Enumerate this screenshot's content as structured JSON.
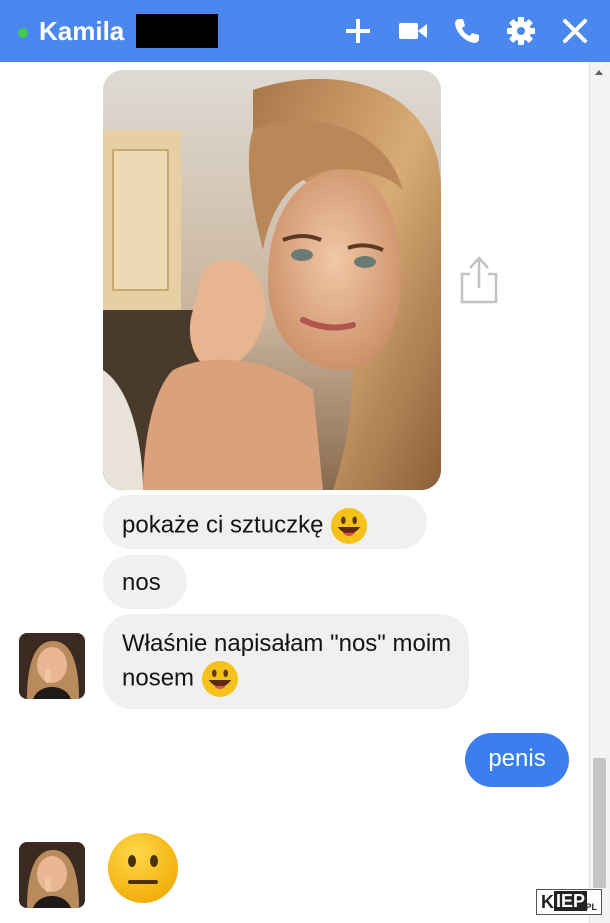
{
  "header": {
    "contact_name": "Kamila",
    "status": "online",
    "icons": [
      "add-icon",
      "video-call-icon",
      "phone-icon",
      "settings-icon",
      "close-icon"
    ]
  },
  "messages": [
    {
      "from": "contact",
      "type": "photo"
    },
    {
      "from": "contact",
      "type": "text",
      "text": "pokaże ci sztuczkę",
      "emoji": "grinning"
    },
    {
      "from": "contact",
      "type": "text",
      "text": "nos"
    },
    {
      "from": "contact",
      "type": "text",
      "text": "Właśnie napisałam \"nos\" moim nosem",
      "emoji": "grinning"
    },
    {
      "from": "me",
      "type": "text",
      "text": "penis"
    },
    {
      "from": "contact",
      "type": "emoji",
      "emoji": "neutral-face"
    }
  ],
  "watermark": {
    "k": "K",
    "ep": "IEP",
    "pl": ".PL"
  },
  "colors": {
    "header": "#4a88f0",
    "my_bubble": "#3b7fee",
    "their_bubble": "#f1f0f0",
    "online": "#42c94d"
  }
}
